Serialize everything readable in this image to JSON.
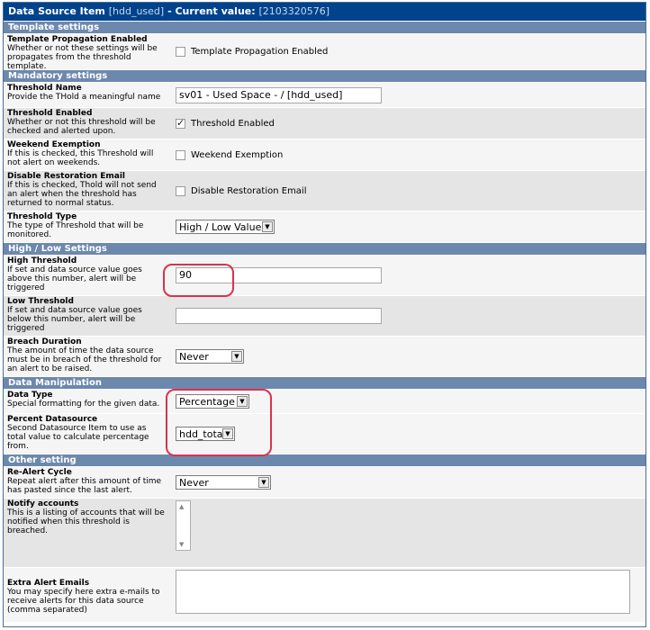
{
  "header": {
    "title_prefix": "Data Source Item",
    "item": "[hdd_used]",
    "current_label": "- Current value:",
    "current_value": "[2103320576]"
  },
  "sections": {
    "template": "Template settings",
    "mandatory": "Mandatory settings",
    "highlow": "High / Low Settings",
    "manipulation": "Data Manipulation",
    "other": "Other setting"
  },
  "fields": {
    "template_propagation": {
      "title": "Template Propagation Enabled",
      "desc": "Whether or not these settings will be propagates from the threshold template.",
      "checkbox_label": "Template Propagation Enabled",
      "checked": false
    },
    "threshold_name": {
      "title": "Threshold Name",
      "desc": "Provide the THold a meaningful name",
      "value": "sv01 - Used Space - / [hdd_used]"
    },
    "threshold_enabled": {
      "title": "Threshold Enabled",
      "desc": "Whether or not this threshold will be checked and alerted upon.",
      "checkbox_label": "Threshold Enabled",
      "checked": true
    },
    "weekend_exemption": {
      "title": "Weekend Exemption",
      "desc": "If this is checked, this Threshold will not alert on weekends.",
      "checkbox_label": "Weekend Exemption",
      "checked": false
    },
    "disable_restoration": {
      "title": "Disable Restoration Email",
      "desc": "If this is checked, Thold will not send an alert when the threshold has returned to normal status.",
      "checkbox_label": "Disable Restoration Email",
      "checked": false
    },
    "threshold_type": {
      "title": "Threshold Type",
      "desc": "The type of Threshold that will be monitored.",
      "value": "High / Low Values"
    },
    "high_threshold": {
      "title": "High Threshold",
      "desc": "If set and data source value goes above this number, alert will be triggered",
      "value": "90"
    },
    "low_threshold": {
      "title": "Low Threshold",
      "desc": "If set and data source value goes below this number, alert will be triggered",
      "value": ""
    },
    "breach_duration": {
      "title": "Breach Duration",
      "desc": "The amount of time the data source must be in breach of the threshold for an alert to be raised.",
      "value": "Never"
    },
    "data_type": {
      "title": "Data Type",
      "desc": "Special formatting for the given data.",
      "value": "Percentage"
    },
    "percent_datasource": {
      "title": "Percent Datasource",
      "desc": "Second Datasource Item to use as total value to calculate percentage from.",
      "value": "hdd_total"
    },
    "realert_cycle": {
      "title": "Re-Alert Cycle",
      "desc": "Repeat alert after this amount of time has pasted since the last alert.",
      "value": "Never"
    },
    "notify_accounts": {
      "title": "Notify accounts",
      "desc": "This is a listing of accounts that will be notified when this threshold is breached."
    },
    "extra_emails": {
      "title": "Extra Alert Emails",
      "desc": "You may specify here extra e-mails to receive alerts for this data source (comma separated)",
      "value": ""
    }
  },
  "colors": {
    "title_bar": "#00438c",
    "section_bar": "#6d88ad",
    "highlight": "#d9334b"
  }
}
